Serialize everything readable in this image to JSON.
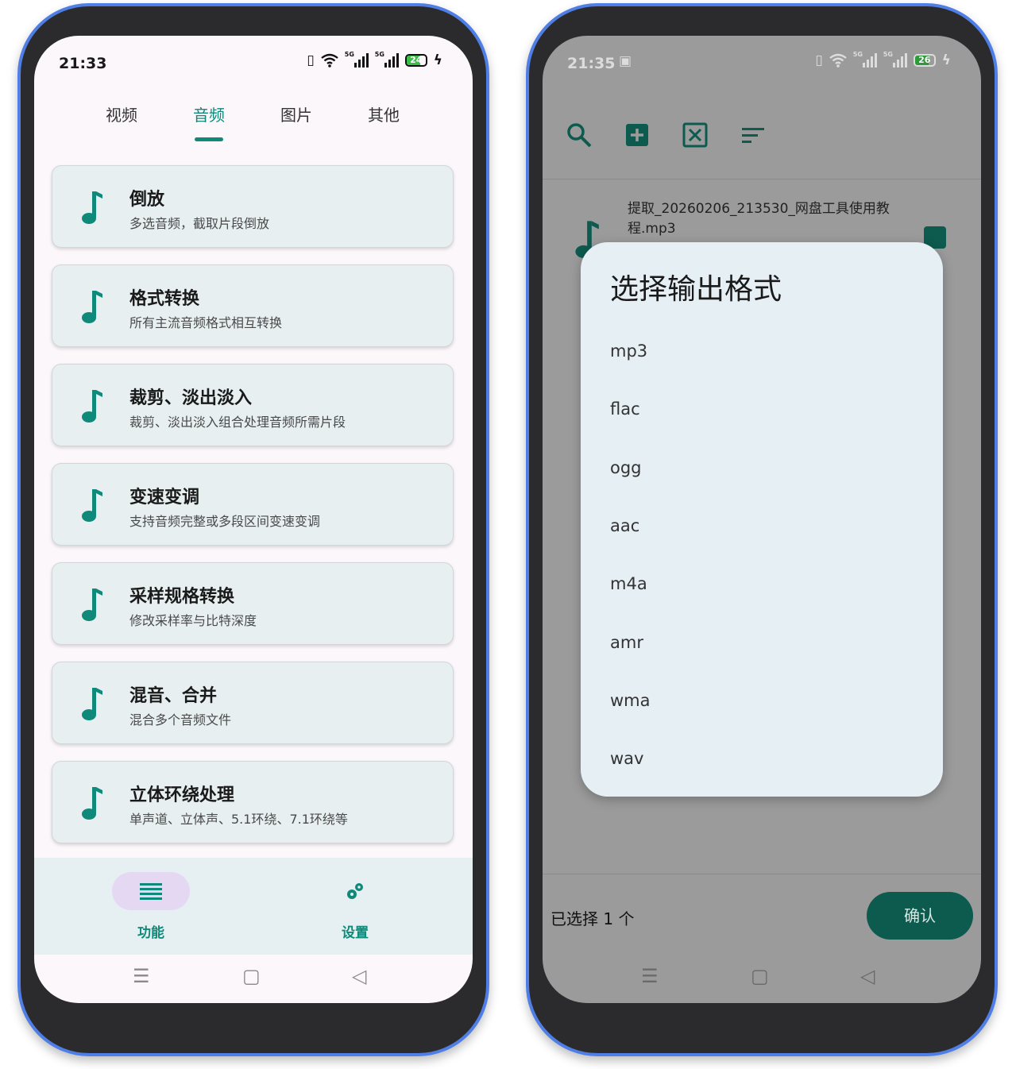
{
  "left": {
    "status_time": "21:33",
    "battery_level": "24",
    "tabs": [
      {
        "label": "视频"
      },
      {
        "label": "音频"
      },
      {
        "label": "图片"
      },
      {
        "label": "其他"
      }
    ],
    "active_tab": "音频",
    "cards": [
      {
        "title": "倒放",
        "subtitle": "多选音频，截取片段倒放"
      },
      {
        "title": "格式转换",
        "subtitle": "所有主流音频格式相互转换"
      },
      {
        "title": "裁剪、淡出淡入",
        "subtitle": "裁剪、淡出淡入组合处理音频所需片段"
      },
      {
        "title": "变速变调",
        "subtitle": "支持音频完整或多段区间变速变调"
      },
      {
        "title": "采样规格转换",
        "subtitle": "修改采样率与比特深度"
      },
      {
        "title": "混音、合并",
        "subtitle": "混合多个音频文件"
      },
      {
        "title": "立体环绕处理",
        "subtitle": "单声道、立体声、5.1环绕、7.1环绕等"
      }
    ],
    "bottom_nav": [
      {
        "label": "功能",
        "icon": "menu-icon",
        "active": true
      },
      {
        "label": "设置",
        "icon": "settings-icon",
        "active": false
      }
    ]
  },
  "right": {
    "status_time": "21:35",
    "battery_level": "26",
    "toolbar_icons": [
      "search-icon",
      "add-box-icon",
      "close-box-icon",
      "sort-icon"
    ],
    "file_name": "提取_20260206_213530_网盘工具使用教程.mp3",
    "dialog": {
      "title": "选择输出格式",
      "options": [
        "mp3",
        "flac",
        "ogg",
        "aac",
        "m4a",
        "amr",
        "wma",
        "wav"
      ]
    },
    "selected_count": "已选择 1 个",
    "confirm_label": "确认"
  },
  "colors": {
    "accent": "#0f8a7a",
    "frame": "#4f7fe6",
    "card_bg": "#e7eff1",
    "confirm_bg": "#0d5a4f"
  }
}
